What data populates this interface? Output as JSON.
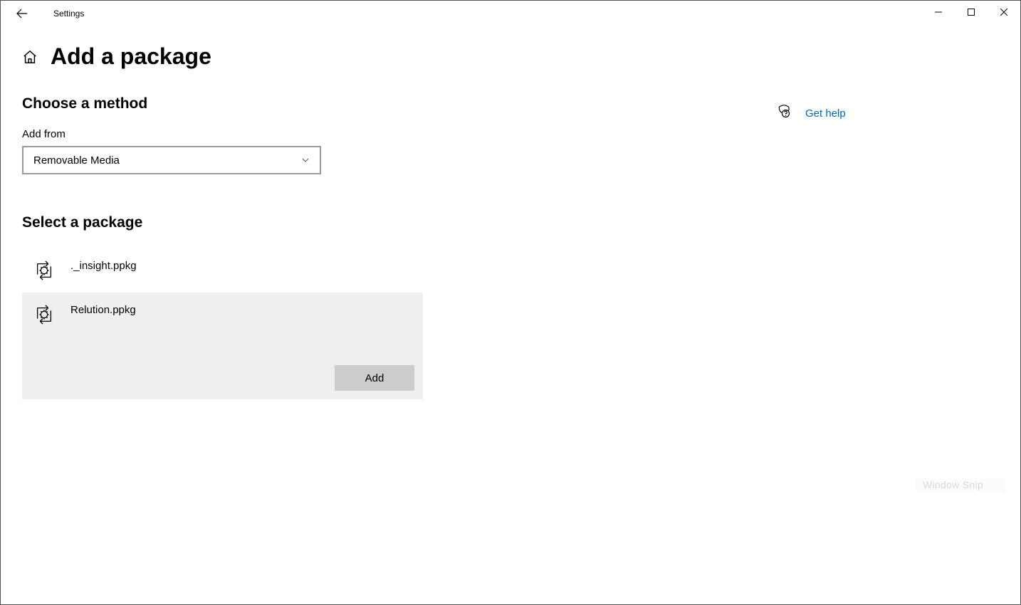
{
  "window": {
    "app_title": "Settings"
  },
  "page": {
    "title": "Add a package"
  },
  "sections": {
    "method": {
      "header": "Choose a method",
      "field_label": "Add from",
      "dropdown_value": "Removable Media"
    },
    "select_package": {
      "header": "Select a package",
      "items": [
        {
          "name": "._insight.ppkg",
          "selected": false
        },
        {
          "name": "Relution.ppkg",
          "selected": true
        }
      ],
      "add_button_label": "Add"
    }
  },
  "help": {
    "link_text": "Get help"
  },
  "watermark": "Window Snip"
}
